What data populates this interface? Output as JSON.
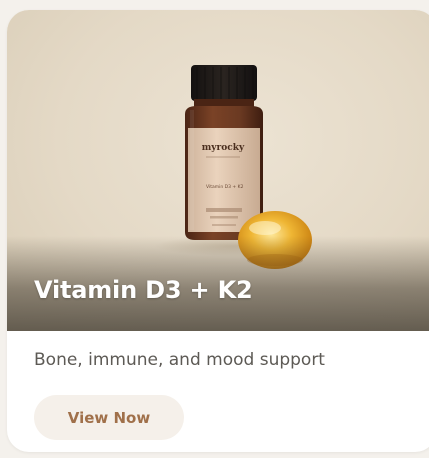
{
  "product": {
    "title": "Vitamin D3 + K2",
    "description": "Bone, immune, and mood support",
    "cta_label": "View Now",
    "bottle_brand": "myrocky",
    "bottle_product": "Vitamin D3 + K2"
  },
  "colors": {
    "hero_background": "#e4d9c6",
    "bottle_glass": "#6b3a22",
    "bottle_cap": "#1e1a17",
    "label": "#e6cdb4",
    "softgel": "#e3a21a",
    "button_bg": "#f5f0ea",
    "button_text": "#a0704a",
    "description_text": "#5d5a55"
  }
}
